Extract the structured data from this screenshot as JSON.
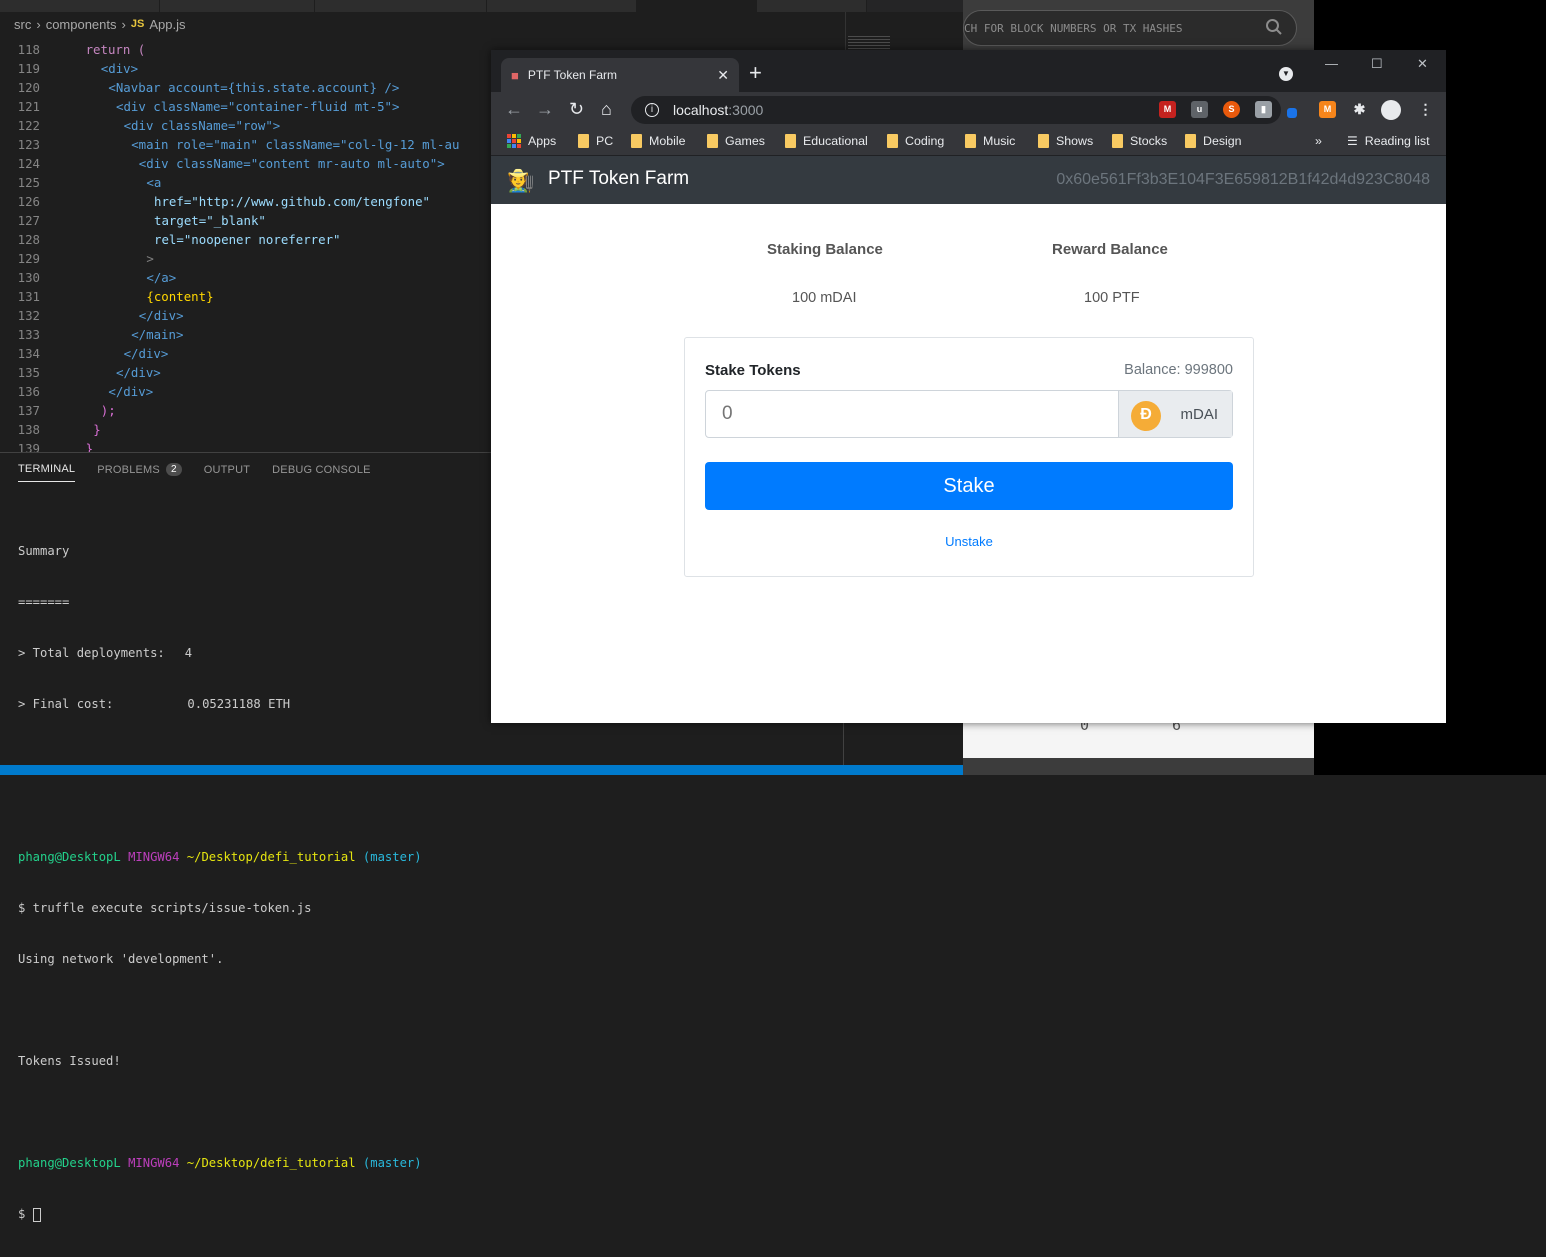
{
  "vscode": {
    "breadcrumb": {
      "part1": "src",
      "part2": "components",
      "file_icon": "JS",
      "file": "App.js"
    },
    "code_lines": [
      {
        "n": "118",
        "text": "return ("
      },
      {
        "n": "119",
        "text": "<div>"
      },
      {
        "n": "120",
        "text": "<Navbar account={this.state.account} />"
      },
      {
        "n": "121",
        "text": "<div className=\"container-fluid mt-5\">"
      },
      {
        "n": "122",
        "text": "<div className=\"row\">"
      },
      {
        "n": "123",
        "text": "<main role=\"main\" className=\"col-lg-12 ml-au"
      },
      {
        "n": "124",
        "text": "<div className=\"content mr-auto ml-auto\">"
      },
      {
        "n": "125",
        "text": "<a"
      },
      {
        "n": "126",
        "text": "href=\"http://www.github.com/tengfone\""
      },
      {
        "n": "127",
        "text": "target=\"_blank\""
      },
      {
        "n": "128",
        "text": "rel=\"noopener noreferrer\""
      },
      {
        "n": "129",
        "text": ">"
      },
      {
        "n": "130",
        "text": "</a>"
      },
      {
        "n": "131",
        "text": "{content}"
      },
      {
        "n": "132",
        "text": "</div>"
      },
      {
        "n": "133",
        "text": "</main>"
      },
      {
        "n": "134",
        "text": "</div>"
      },
      {
        "n": "135",
        "text": "</div>"
      },
      {
        "n": "136",
        "text": "</div>"
      },
      {
        "n": "137",
        "text": ");"
      },
      {
        "n": "138",
        "text": "}"
      },
      {
        "n": "139",
        "text": "}"
      }
    ],
    "panel_tabs": {
      "terminal": "TERMINAL",
      "problems": "PROBLEMS",
      "problems_count": "2",
      "output": "OUTPUT",
      "debug": "DEBUG CONSOLE"
    },
    "terminal": {
      "summary": "Summary",
      "rule": "=======",
      "deployments_label": "> Total deployments:",
      "deployments_value": "4",
      "cost_label": "> Final cost:",
      "cost_value": "0.05231188 ETH",
      "prompt_user": "phang@DesktopL",
      "prompt_env": "MINGW64",
      "prompt_path": "~/Desktop/defi_tutorial",
      "prompt_branch": "(master)",
      "command": "$ truffle execute scripts/issue-token.js",
      "network_line": "Using network 'development'.",
      "result_line": "Tokens Issued!",
      "prompt2_user": "phang@DesktopL",
      "prompt2_env": "MINGW64",
      "prompt2_path": "~/Desktop/defi_tutorial",
      "prompt2_branch": "(master)",
      "dollar": "$"
    }
  },
  "background": {
    "search_placeholder": "CH FOR BLOCK NUMBERS OR TX HASHES",
    "n1": "0",
    "n2": "6"
  },
  "chrome": {
    "tab_title": "PTF Token Farm",
    "url_host": "localhost",
    "url_port": ":3000",
    "bookmarks": [
      "Apps",
      "PC",
      "Mobile",
      "Games",
      "Educational",
      "Coding",
      "Music",
      "Shows",
      "Stocks",
      "Design"
    ],
    "more": "»",
    "reading_list": "Reading list"
  },
  "app": {
    "brand": "PTF Token Farm",
    "account": "0x60e561Ff3b3E104F3E659812B1f42d4d923C8048",
    "staking_label": "Staking Balance",
    "reward_label": "Reward Balance",
    "staking_value": "100 mDAI",
    "reward_value": "100 PTF",
    "stake_title": "Stake Tokens",
    "balance_text": "Balance: 999800",
    "amount_placeholder": "0",
    "token_label": "mDAI",
    "stake_button": "Stake",
    "unstake_button": "Unstake"
  },
  "colors": {
    "accent": "#007bff",
    "navbar": "#343a40",
    "vscode_bg": "#1e1e1e",
    "statusbar": "#007acc"
  }
}
